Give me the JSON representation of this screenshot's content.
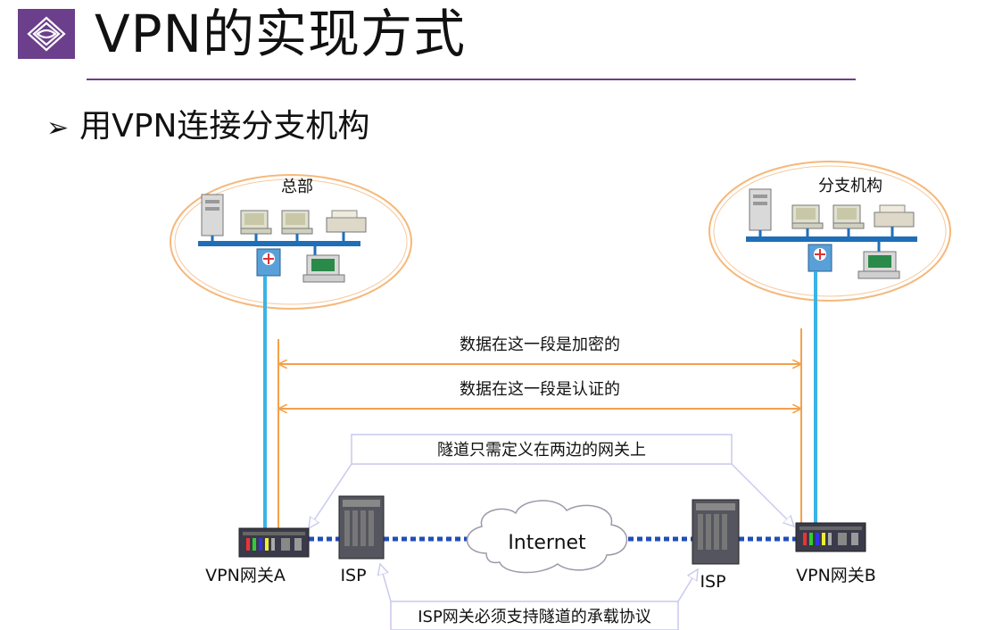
{
  "slide": {
    "title": "VPN的实现方式",
    "subtitle": "用VPN连接分支机构"
  },
  "diagram": {
    "hq_label": "总部",
    "branch_label": "分支机构",
    "encrypted_label": "数据在这一段是加密的",
    "authenticated_label": "数据在这一段是认证的",
    "tunnel_note": "隧道只需定义在两边的网关上",
    "internet_label": "Internet",
    "gateway_a_label": "VPN网关A",
    "gateway_b_label": "VPN网关B",
    "isp_left_label": "ISP",
    "isp_right_label": "ISP",
    "isp_note": "ISP网关必须支持隧道的承载协议"
  },
  "colors": {
    "accent": "#6b3f8c",
    "orange": "#f5a04a",
    "network_blue": "#1f6fb8",
    "link_cyan": "#3ab4e6",
    "note_line": "#c9c9ee"
  }
}
